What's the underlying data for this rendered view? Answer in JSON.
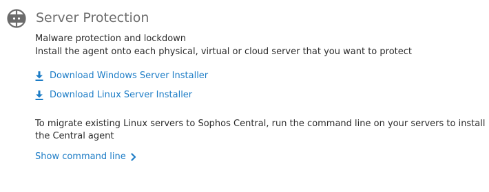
{
  "section": {
    "title": "Server Protection",
    "icon": "server-icon",
    "description_line1": "Malware protection and lockdown",
    "description_line2": "Install the agent onto each physical, virtual or cloud server that you want to protect"
  },
  "downloads": [
    {
      "label": "Download Windows Server Installer",
      "icon": "download-icon"
    },
    {
      "label": "Download Linux Server Installer",
      "icon": "download-icon"
    }
  ],
  "migrate": {
    "line1": "To migrate existing Linux servers to Sophos Central, run the command line on your servers to install",
    "line2": "the Central agent"
  },
  "show_command": {
    "label": "Show command line",
    "icon": "chevron-right-icon"
  },
  "colors": {
    "link": "#1c7cc6",
    "title": "#6d6d6d",
    "icon": "#6b6b6b",
    "text": "#2b2b2b"
  }
}
